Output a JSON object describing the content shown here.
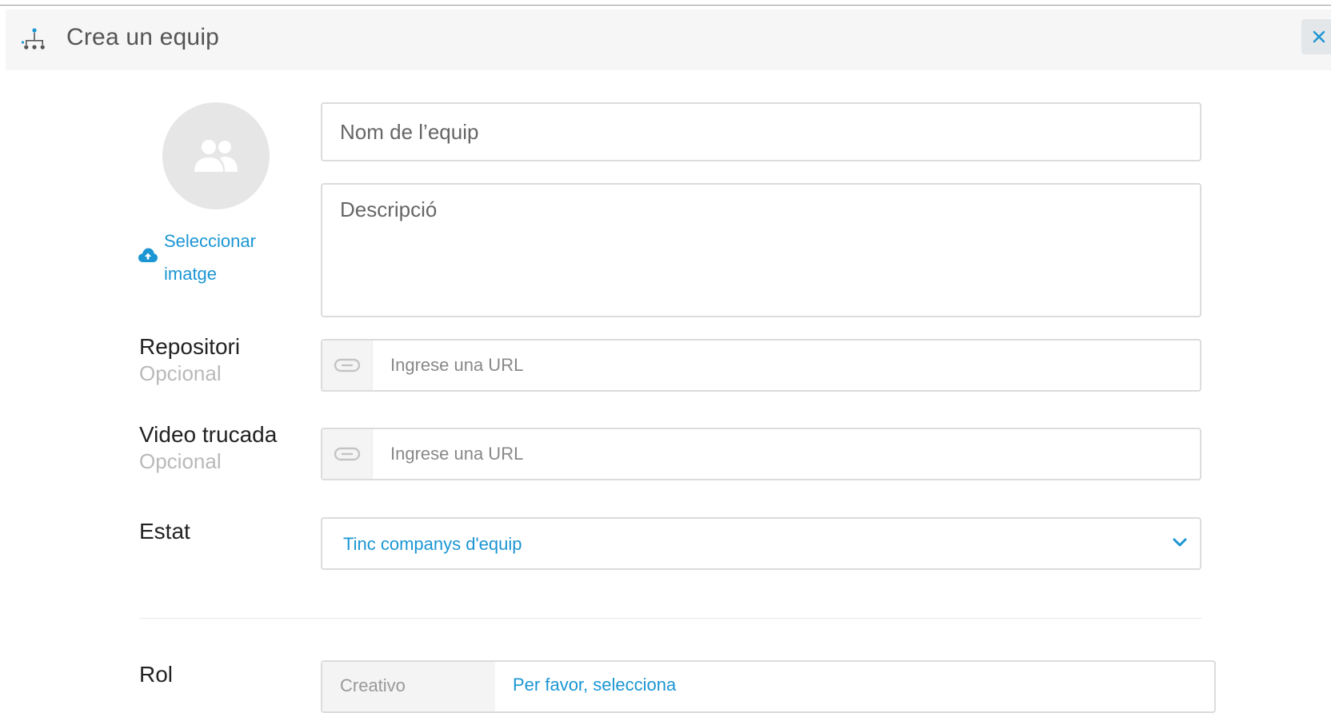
{
  "dialog": {
    "title": "Crea un equip",
    "close_label": "×"
  },
  "image_picker": {
    "label": "Seleccionar imatge"
  },
  "team_name": {
    "placeholder": "Nom de l’equip",
    "value": ""
  },
  "description": {
    "placeholder": "Descripció",
    "value": ""
  },
  "repository": {
    "label": "Repositori",
    "optional": "Opcional",
    "placeholder": "Ingrese una URL",
    "value": ""
  },
  "video_call": {
    "label": "Video trucada",
    "optional": "Opcional",
    "placeholder": "Ingrese una URL",
    "value": ""
  },
  "status": {
    "label": "Estat",
    "selected": "Tinc companys d'equip"
  },
  "role": {
    "label": "Rol",
    "prefix": "Creativo",
    "selected": "Per favor, selecciona"
  },
  "icons": {
    "header": "team-hierarchy-icon",
    "close": "close-icon",
    "avatar": "users-icon",
    "upload": "cloud-upload-icon",
    "link": "link-icon",
    "dropdown": "chevron-down-icon"
  },
  "colors": {
    "accent": "#1b96d3",
    "header_bg": "#f6f6f6",
    "border": "#dcdcdc",
    "muted": "#b9b9b9"
  }
}
